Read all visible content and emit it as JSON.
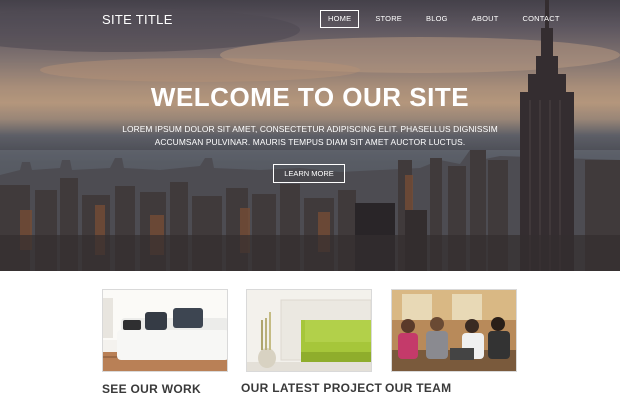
{
  "header": {
    "site_title": "SITE TITLE",
    "nav": [
      {
        "label": "HOME",
        "active": true
      },
      {
        "label": "STORE",
        "active": false
      },
      {
        "label": "BLOG",
        "active": false
      },
      {
        "label": "ABOUT",
        "active": false
      },
      {
        "label": "CONTACT",
        "active": false
      }
    ]
  },
  "hero": {
    "title": "WELCOME TO OUR SITE",
    "subtitle": "LOREM IPSUM DOLOR SIT AMET, CONSECTETUR ADIPISCING ELIT. PHASELLUS DIGNISSIM ACCUMSAN PULVINAR. MAURIS TEMPUS DIAM SIT AMET AUCTOR LUCTUS.",
    "button_label": "LEARN MORE",
    "image": "city-skyline-photo"
  },
  "features": [
    {
      "title": "SEE OUR WORK",
      "image": "living-room-sofa-photo"
    },
    {
      "title": "OUR LATEST PROJECT",
      "image": "green-chair-vase-photo"
    },
    {
      "title": "OUR TEAM",
      "image": "team-meeting-photo"
    }
  ],
  "colors": {
    "accent_green": "#a6c63a",
    "text_dark": "#3a3a3a",
    "white": "#ffffff"
  }
}
